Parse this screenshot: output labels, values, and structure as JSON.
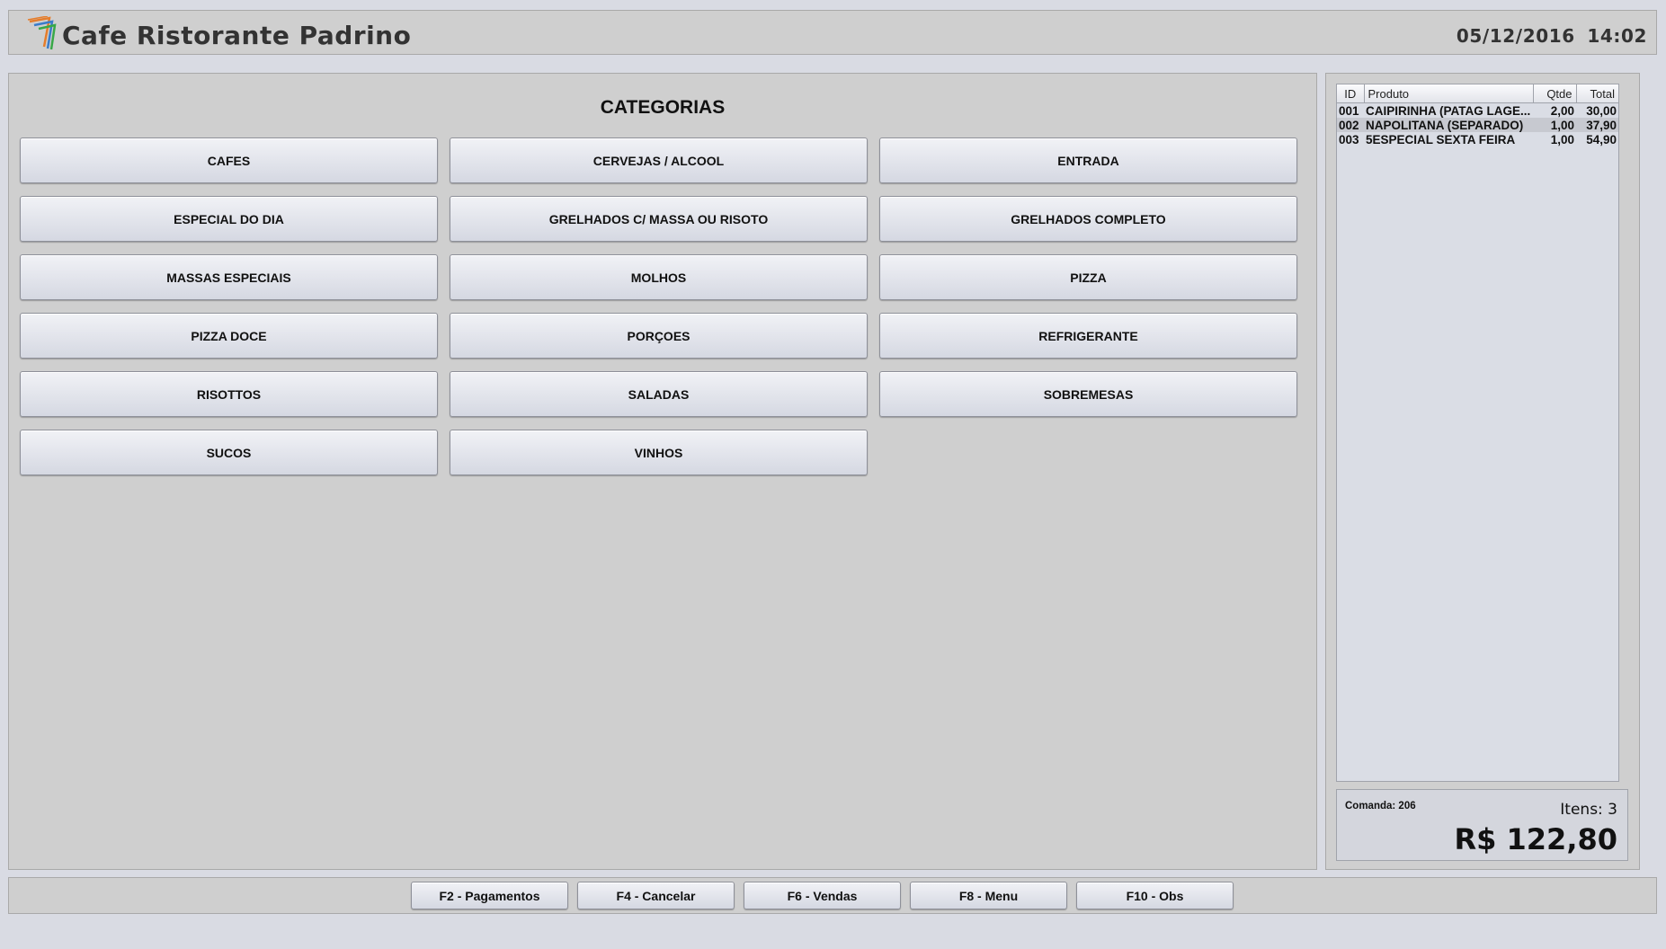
{
  "header": {
    "title": "Cafe Ristorante Padrino",
    "datetime": "05/12/2016  14:02"
  },
  "categories": {
    "title": "CATEGORIAS",
    "items": [
      "CAFES",
      "CERVEJAS / ALCOOL",
      "ENTRADA",
      "ESPECIAL DO DIA",
      "GRELHADOS C/ MASSA OU RISOTO",
      "GRELHADOS COMPLETO",
      "MASSAS ESPECIAIS",
      "MOLHOS",
      "PIZZA",
      "PIZZA DOCE",
      "PORÇOES",
      "REFRIGERANTE",
      "RISOTTOS",
      "SALADAS",
      "SOBREMESAS",
      "SUCOS",
      "VINHOS"
    ]
  },
  "order": {
    "columns": [
      "ID",
      "Produto",
      "Qtde",
      "Total"
    ],
    "rows": [
      {
        "id": "001",
        "produto": "CAIPIRINHA (PATAG LAGE...",
        "qtde": "2,00",
        "total": "30,00"
      },
      {
        "id": "002",
        "produto": "NAPOLITANA (SEPARADO)",
        "qtde": "1,00",
        "total": "37,90"
      },
      {
        "id": "003",
        "produto": "5ESPECIAL SEXTA FEIRA",
        "qtde": "1,00",
        "total": "54,90"
      }
    ],
    "comanda": "Comanda: 206",
    "itens": "Itens: 3",
    "total": "R$ 122,80"
  },
  "footer": {
    "buttons": [
      "F2 - Pagamentos",
      "F4 - Cancelar",
      "F6 - Vendas",
      "F8 - Menu",
      "F10 - Obs"
    ]
  },
  "colors": {
    "background": "#d9dbe3",
    "panel": "#cfcfcf",
    "button_top": "#f1f2f6",
    "button_bottom": "#d5d8e2",
    "selected_row": "#c7c9d0"
  }
}
